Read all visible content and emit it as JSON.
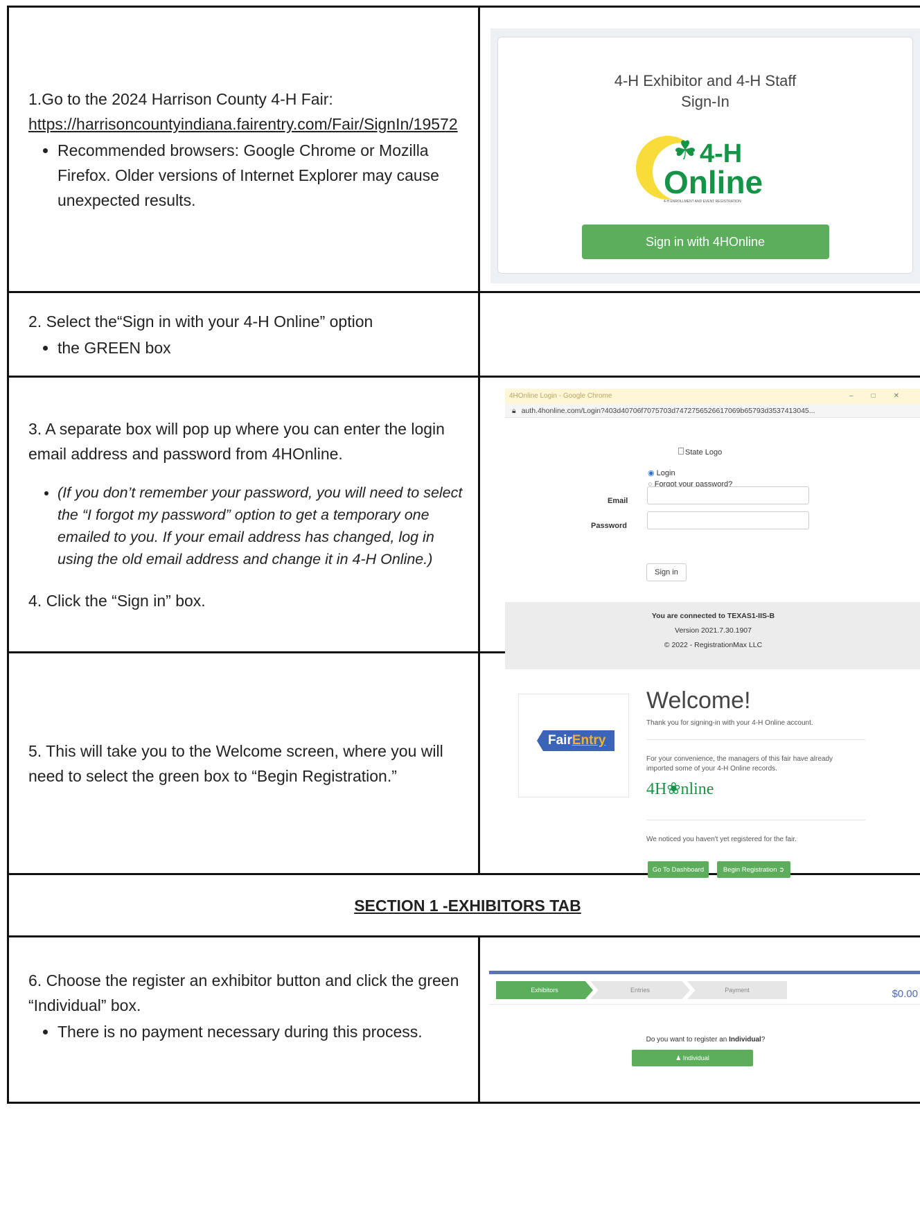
{
  "step1": {
    "text": "1.Go to the 2024 Harrison County 4-H Fair:",
    "link": "https://harrisoncountyindiana.fairentry.com/Fair/SignIn/19572",
    "bullet": "Recommended browsers: Google Chrome or Mozilla Firefox. Older versions of Internet Explorer may cause unexpected results."
  },
  "screen1": {
    "title_line1": "4-H Exhibitor and 4-H Staff",
    "title_line2": "Sign-In",
    "logo_top": "4-H",
    "logo_bottom": "Online",
    "logo_tagline": "4-H ENROLLMENT AND EVENT REGISTRATION",
    "button": "Sign in with 4HOnline"
  },
  "step2": {
    "text": "2. Select the“Sign in with your 4-H Online” option",
    "bullet": "the GREEN box"
  },
  "step3": {
    "text": "3. A separate box will pop up where you can enter the login email address and password from 4HOnline.",
    "bullet": "(If you don’t remember your password, you will need to select the “I forgot my password” option to get a temporary one emailed to you. If your email address has changed, log in using the old email address and change it in 4-H Online.)",
    "step4": "4. Click the “Sign in” box."
  },
  "screen3": {
    "window_title": "4HOnline Login - Google Chrome",
    "address": "auth.4honline.com/Login?403d40706f7075703d7472756526617069b65793d3537413045...",
    "state_logo": "State Logo",
    "radio_login": "Login",
    "radio_forgot": "Forgot your password?",
    "email_label": "Email",
    "password_label": "Password",
    "signin_button": "Sign in",
    "footer_line1": "You are connected to TEXAS1-IIS-B",
    "footer_line2": "Version 2021.7.30.1907",
    "footer_line3": "© 2022 - RegistrationMax LLC"
  },
  "step5": {
    "text": "5. This will take you to the Welcome screen, where you will need to select the green box to “Begin Registration.”"
  },
  "screen5": {
    "brand_fair": "Fair",
    "brand_entry": "Entry",
    "welcome": "Welcome!",
    "thanks": "Thank you for signing-in with your 4-H Online account.",
    "convenience": "For your convenience, the managers of this fair have already imported some of your 4-H Online records.",
    "h4_logo": "4H❀nline",
    "noticed": "We noticed you haven't yet registered for the fair.",
    "btn_dashboard": "Go To Dashboard",
    "btn_begin": "Begin Registration ➲"
  },
  "section1": {
    "heading": "SECTION 1 -EXHIBITORS TAB"
  },
  "step6": {
    "text": "6. Choose the register an exhibitor button and click the green “Individual” box.",
    "bullet": "There is no payment necessary during this process."
  },
  "screen6": {
    "step_exhibitors": "Exhibitors",
    "step_entries": "Entries",
    "step_payment": "Payment",
    "amount": "$0.00",
    "question_pre": "Do you want to register an ",
    "question_bold": "Individual",
    "question_post": "?",
    "individual_button": "♟ Individual"
  }
}
